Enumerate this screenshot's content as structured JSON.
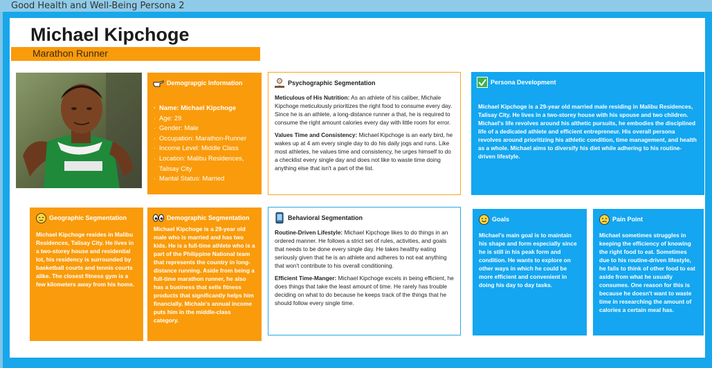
{
  "window": {
    "tab_title": "Good Health and Well-Being Persona 2"
  },
  "header": {
    "name": "Michael Kipchoge",
    "role": "Marathon Runner"
  },
  "demographic": {
    "title": "Demograpgic Information",
    "icon": "pointing-hand-icon",
    "items": [
      "Name: Michael Kipchoge",
      "Age: 29",
      "Gender: Male",
      "Occupation: Marathon-Runner",
      "Income Level: Middle Class",
      "Location: Malibu Residences, Talisay City",
      "Marital Status: Married"
    ]
  },
  "psychographic": {
    "title": "Psychographic Segmentation",
    "icon": "person-at-desk-icon",
    "p1_lead": "Meticulous of His Nutrition:",
    "p1_text": " As an athlete of his caliber, Michale Kipchoge meticulously prioritizes the right food to consume every day. Since he is an athlete, a long-distance runner a that, he is required to consume the right amount calories every day with little room for error.",
    "p2_lead": "Values Time and Consistency:",
    "p2_text": " Michael Kipchoge is an early bird, he wakes up at 4 am every single day to do his daily jogs and runs. Like most athletes, he values time and consistency, he urges himself to do a checklist every single day and does not like to waste time doing anything else that isn't a part of the list."
  },
  "persona_development": {
    "title": "Persona Development",
    "icon": "check-box-icon",
    "text": "Michael Kipchoge is a 29-year old married male residing in Malibu Residences, Talisay City. He lives in a two-storey house with his spouse and two children. Michael's life revolves around his althetic pursuits, he embodies the disciplined life of a dedicated athlete and efficient entrepreneur. His overall persona revolves around prioritizing his athletic condition, time management, and health as a whole. Michael aims to diversify his diet while adhering to his routine-driven lifestyle."
  },
  "geographic": {
    "title": "Geographic Segmentation",
    "icon": "relieved-face-icon",
    "text": "Michael Kipchoge resides in Malibu Residences, Talisay City. He lives in a two-storey house and residential lot, his residency is surrounded by basketball courts and tennis courts alike. The closest fitness gym is a few kilometers away from his home."
  },
  "demographic_seg": {
    "title": "Demographic Segmentation",
    "icon": "eyes-icon",
    "text": "Michael Kipchoge is a 29-year old male who is married and has two kids. He is a full-time athlete who is a part of the Philippine National team that represents the country in long-distance running. Aside from being a full-time marathon runner, he also has a business that sells fitness products that significantly helps him financially. Michale's annual income puts him in the middle-class category."
  },
  "behavioral": {
    "title": "Behavioral Segmentation",
    "icon": "mobile-phone-icon",
    "p1_lead": "Routine-Driven Lifestyle:",
    "p1_text": " Michael Kipchoge likes to do things in an ordered manner. He follows a strict set of rules, activities, and goals that needs to be done every single day. He takes healthy eating seriously given that he is an athlete and adheres to not eat anything that won't contribute to his overall conditioning.",
    "p2_lead": "Efficient Time-Manger:",
    "p2_text": " Michael Kipchoge excels in being efficient, he does things that take the least amount of time. He rarely has trouble deciding on what to do because he keeps track of the things that he should follow every single time."
  },
  "goals": {
    "title": "Goals",
    "icon": "smiling-face-icon",
    "text": "Michael's main goal is to maintain his shape and form especially since he is still in his peak form and condition. He wants to explore on other ways in which he could be more efficient and convenient in doing his day to day tasks."
  },
  "pain_point": {
    "title": "Pain Point",
    "icon": "worried-face-icon",
    "text": "Michael sometimes struggles in keeping the efficiency of knowing the right food to eat. Sometimes due to his routine-driven lifestyle, he fails to think of other food to eat aside from what he usually consumes. One reason for this is because he doesn't want to waste time in researching the amount of calories a certain meal has."
  },
  "colors": {
    "orange": "#f99b0b",
    "blue": "#14a6f0",
    "frame": "#17a7ea"
  }
}
